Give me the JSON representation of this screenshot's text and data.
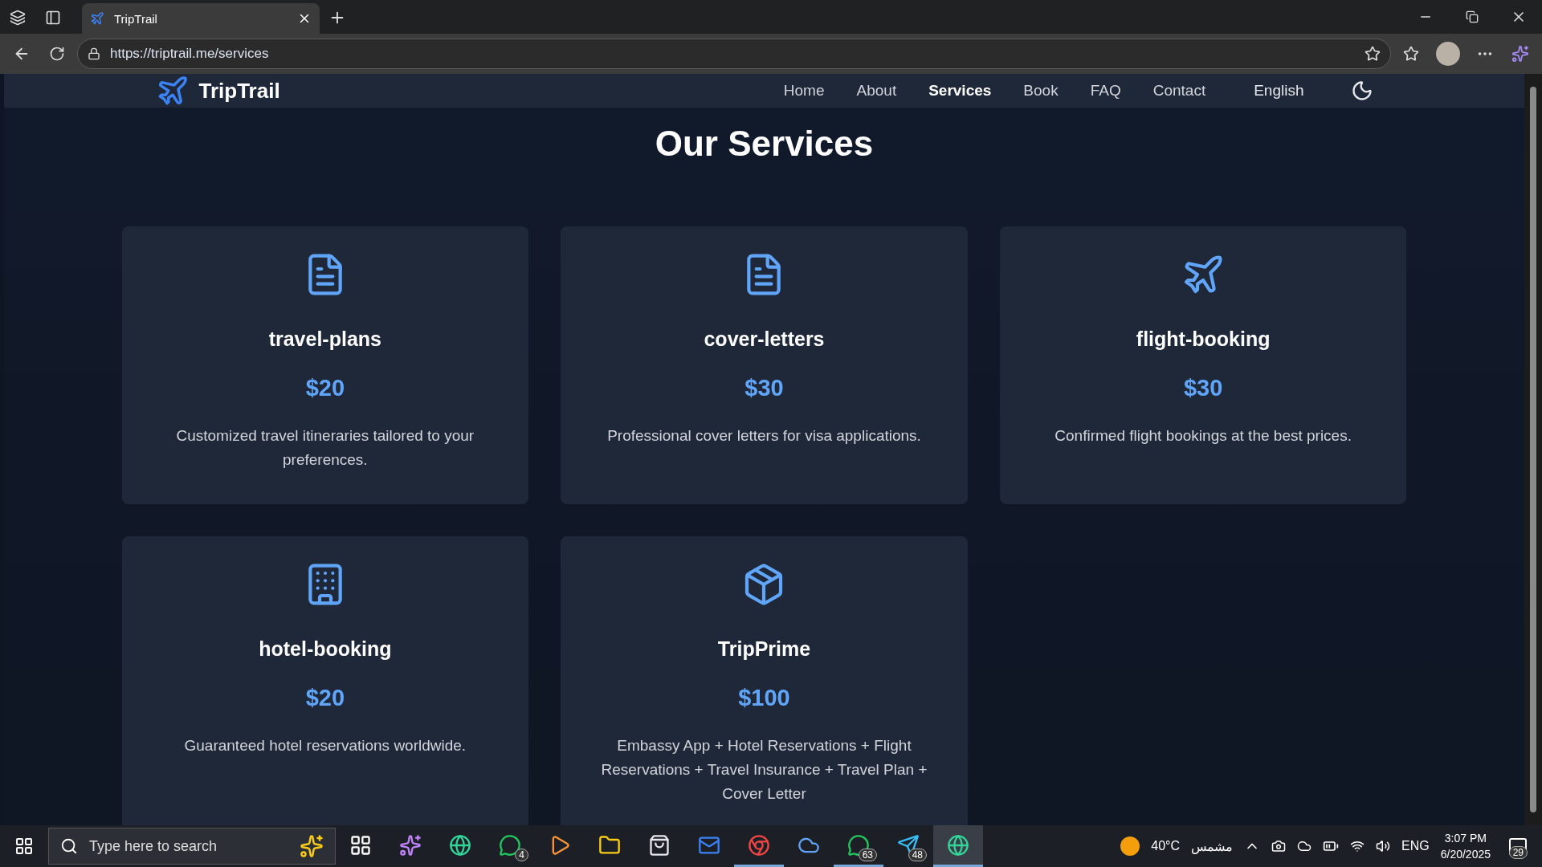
{
  "browser": {
    "tab": {
      "title": "TripTrail",
      "selected": true
    },
    "url": "https://triptrail.me/services"
  },
  "navbar": {
    "brand": "TripTrail",
    "links": [
      {
        "label": "Home",
        "selected": false
      },
      {
        "label": "About",
        "selected": false
      },
      {
        "label": "Services",
        "selected": true
      },
      {
        "label": "Book",
        "selected": false
      },
      {
        "label": "FAQ",
        "selected": false
      },
      {
        "label": "Contact",
        "selected": false
      }
    ],
    "language": "English"
  },
  "heading": "Our Services",
  "services": [
    {
      "kind": "document",
      "title": "travel-plans",
      "price": "$20",
      "description": "Customized travel itineraries tailored to your preferences."
    },
    {
      "kind": "document",
      "title": "cover-letters",
      "price": "$30",
      "description": "Professional cover letters for visa applications."
    },
    {
      "kind": "plane",
      "title": "flight-booking",
      "price": "$30",
      "description": "Confirmed flight bookings at the best prices."
    },
    {
      "kind": "building",
      "title": "hotel-booking",
      "price": "$20",
      "description": "Guaranteed hotel reservations worldwide."
    },
    {
      "kind": "package",
      "title": "TripPrime",
      "price": "$100",
      "description": "Embassy App + Hotel Reservations + Flight Reservations + Travel Insurance + Travel Plan + Cover Letter"
    }
  ],
  "taskbar": {
    "search": {
      "placeholder": "Type here to search"
    },
    "apps": [
      {
        "kind": "taskview",
        "running": false,
        "active": false
      },
      {
        "kind": "copilot",
        "running": false,
        "active": false
      },
      {
        "kind": "edge",
        "running": false,
        "active": false
      },
      {
        "kind": "chat",
        "badge": "4",
        "running": false,
        "active": false
      },
      {
        "kind": "media",
        "running": false,
        "active": false
      },
      {
        "kind": "folder",
        "running": false,
        "active": false
      },
      {
        "kind": "store",
        "running": false,
        "active": false
      },
      {
        "kind": "mail",
        "running": false,
        "active": false
      },
      {
        "kind": "chrome",
        "running": true,
        "active": false
      },
      {
        "kind": "cloud",
        "running": false,
        "active": false
      },
      {
        "kind": "chat",
        "badge": "63",
        "running": true,
        "active": false
      },
      {
        "kind": "send",
        "badge": "48",
        "running": false,
        "active": false
      },
      {
        "kind": "edge",
        "running": true,
        "active": true
      }
    ],
    "weather": {
      "temperature": "40°C",
      "condition": "مشمس"
    },
    "language": "ENG",
    "time": "3:07 PM",
    "date": "6/20/2025",
    "notifications": "29"
  }
}
